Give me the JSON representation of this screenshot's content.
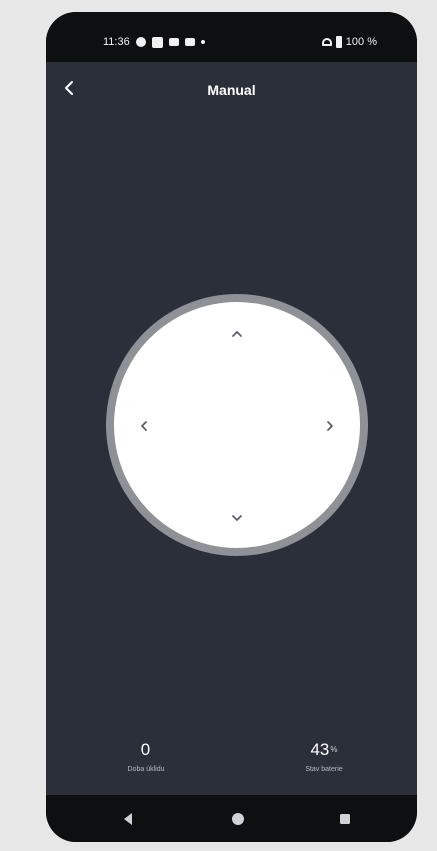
{
  "status_bar": {
    "time": "11:36",
    "battery_percent": "100 %",
    "icons": [
      "notification-icon",
      "app-icon",
      "mail-icon",
      "video-icon",
      "dot-icon",
      "wifi-icon",
      "battery-icon"
    ]
  },
  "header": {
    "title": "Manual",
    "back_icon": "chevron-left-icon"
  },
  "dpad": {
    "up_icon": "chevron-up-icon",
    "down_icon": "chevron-down-icon",
    "left_icon": "chevron-left-icon",
    "right_icon": "chevron-right-icon"
  },
  "stats": {
    "cleaning_time": {
      "value": "0",
      "unit": "",
      "label": "Doba úklidu"
    },
    "battery": {
      "value": "43",
      "unit": "%",
      "label": "Stav baterie"
    }
  },
  "nav": {
    "back_icon": "triangle-back-icon",
    "home_icon": "circle-home-icon",
    "recent_icon": "square-recent-icon"
  },
  "colors": {
    "screen_bg": "#2b2f39",
    "frame": "#0e0f11",
    "dpad_ring": "#8e9196",
    "dpad_fill": "#ffffff"
  }
}
